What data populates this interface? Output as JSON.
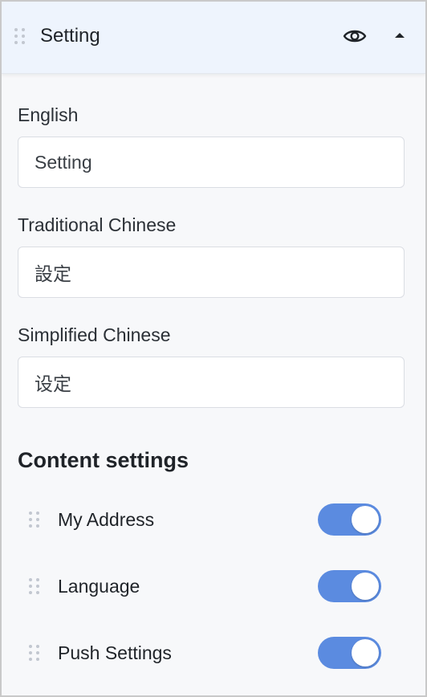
{
  "header": {
    "title": "Setting",
    "visibility_icon": "eye-icon",
    "collapse_icon": "caret-up-icon"
  },
  "fields": [
    {
      "label": "English",
      "value": "Setting"
    },
    {
      "label": "Traditional Chinese",
      "value": "設定"
    },
    {
      "label": "Simplified Chinese",
      "value": "设定"
    }
  ],
  "content_settings": {
    "title": "Content settings",
    "items": [
      {
        "label": "My Address",
        "enabled": true
      },
      {
        "label": "Language",
        "enabled": true
      },
      {
        "label": "Push Settings",
        "enabled": true
      }
    ]
  },
  "colors": {
    "header_bg": "#eef4fd",
    "toggle_on": "#5b8be0",
    "panel_bg": "#f7f8fa"
  }
}
